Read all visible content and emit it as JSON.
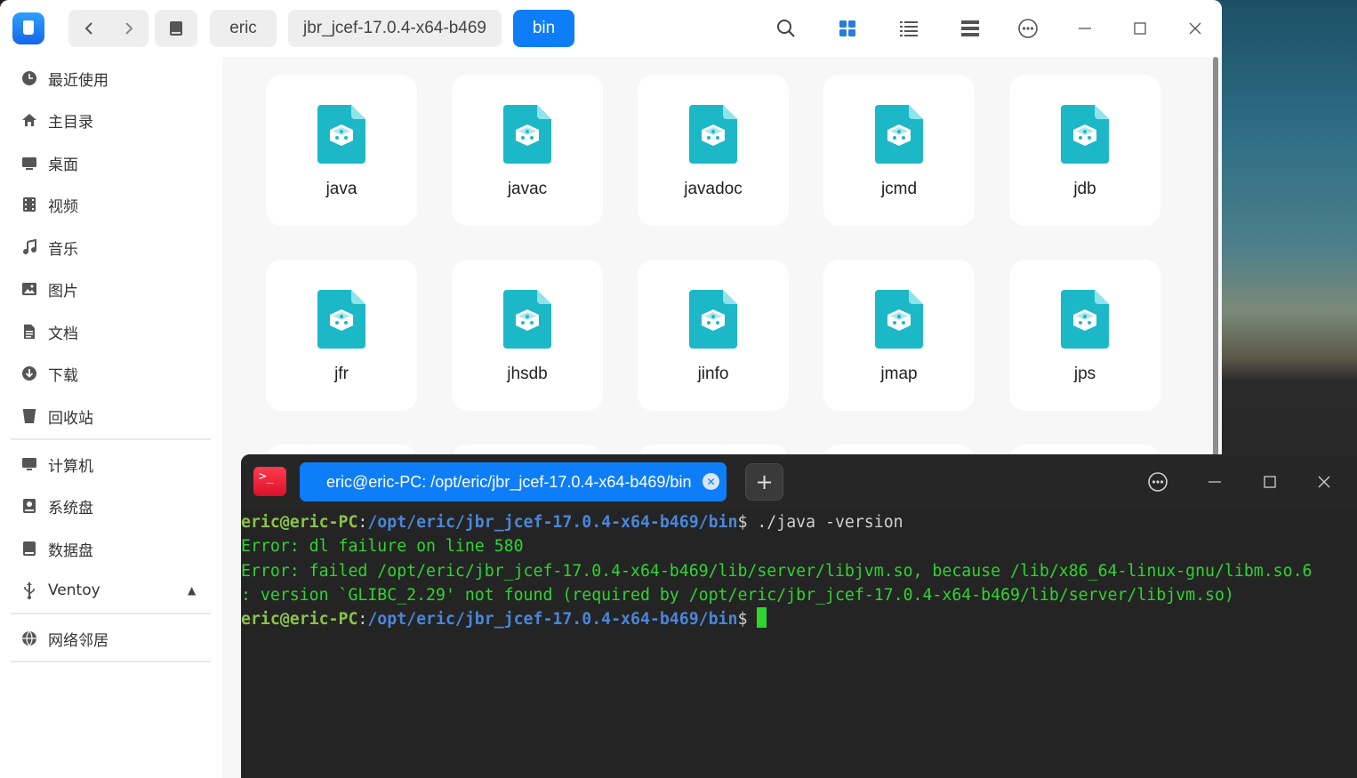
{
  "file_manager": {
    "nav": {
      "back_icon": "chevron-left-icon",
      "forward_icon": "chevron-right-icon"
    },
    "breadcrumb": [
      "eric",
      "jbr_jcef-17.0.4-x64-b469",
      "bin"
    ],
    "toolbar_icons": [
      "search-icon",
      "icon-view-icon",
      "list-view-icon",
      "detail-view-icon",
      "more-icon",
      "minimize-icon",
      "maximize-icon",
      "close-icon"
    ],
    "sidebar": {
      "group1": [
        {
          "label": "最近使用",
          "icon": "clock-icon"
        },
        {
          "label": "主目录",
          "icon": "home-icon"
        },
        {
          "label": "桌面",
          "icon": "desktop-icon"
        },
        {
          "label": "视频",
          "icon": "video-icon"
        },
        {
          "label": "音乐",
          "icon": "music-icon"
        },
        {
          "label": "图片",
          "icon": "picture-icon"
        },
        {
          "label": "文档",
          "icon": "document-icon"
        },
        {
          "label": "下载",
          "icon": "download-icon"
        },
        {
          "label": "回收站",
          "icon": "trash-icon"
        }
      ],
      "group2": [
        {
          "label": "计算机",
          "icon": "computer-icon"
        },
        {
          "label": "系统盘",
          "icon": "disk-icon"
        },
        {
          "label": "数据盘",
          "icon": "disk-icon"
        },
        {
          "label": "Ventoy",
          "icon": "usb-icon"
        }
      ],
      "group3": [
        {
          "label": "网络邻居",
          "icon": "network-icon"
        }
      ]
    },
    "files": [
      "java",
      "javac",
      "javadoc",
      "jcmd",
      "jdb",
      "jfr",
      "jhsdb",
      "jinfo",
      "jmap",
      "jps"
    ],
    "accent_color": "#0d7ef8",
    "file_icon_color": "#1cb8c8"
  },
  "terminal": {
    "tab_title": "eric@eric-PC: /opt/eric/jbr_jcef-17.0.4-x64-b469/bin",
    "add_tab_label": "+",
    "lines": [
      {
        "user": "eric@eric-PC",
        "sep": ":",
        "path": "/opt/eric/jbr_jcef-17.0.4-x64-b469/bin",
        "suffix": "$ ",
        "cmd": "./java -version"
      },
      {
        "text": "Error: dl failure on line 580"
      },
      {
        "text": "Error: failed /opt/eric/jbr_jcef-17.0.4-x64-b469/lib/server/libjvm.so, because /lib/x86_64-linux-gnu/libm.so.6"
      },
      {
        "text": ": version `GLIBC_2.29' not found (required by /opt/eric/jbr_jcef-17.0.4-x64-b469/lib/server/libjvm.so)"
      },
      {
        "user": "eric@eric-PC",
        "sep": ":",
        "path": "/opt/eric/jbr_jcef-17.0.4-x64-b469/bin",
        "suffix": "$ ",
        "cmd": ""
      }
    ]
  }
}
